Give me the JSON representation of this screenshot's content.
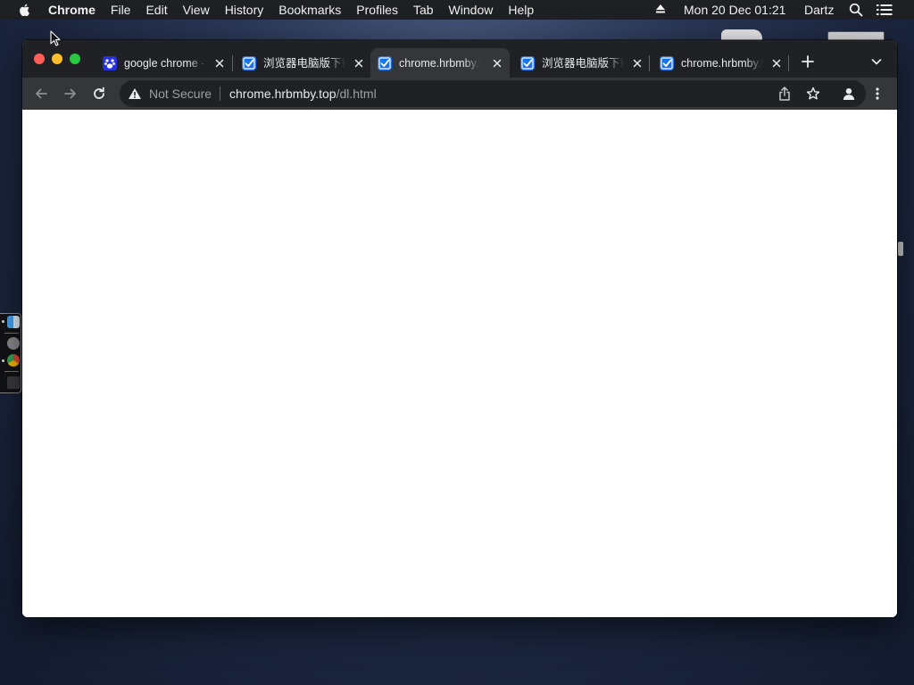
{
  "menubar": {
    "app_name": "Chrome",
    "menus": [
      "File",
      "Edit",
      "View",
      "History",
      "Bookmarks",
      "Profiles",
      "Tab",
      "Window",
      "Help"
    ],
    "clock": "Mon 20 Dec  01:21",
    "user": "Dartz"
  },
  "tabs": [
    {
      "title": "google chrome - 百度搜索",
      "favicon": "baidu-paw-icon",
      "active": false
    },
    {
      "title": "浏览器电脑版下载",
      "favicon": "checkbox-favicon-icon",
      "active": false
    },
    {
      "title": "chrome.hrbmby.top",
      "favicon": "checkbox-favicon-icon",
      "active": true
    },
    {
      "title": "浏览器电脑版下载",
      "favicon": "checkbox-favicon-icon",
      "active": false
    },
    {
      "title": "chrome.hrbmby.top",
      "favicon": "checkbox-favicon-icon",
      "active": false
    }
  ],
  "omnibox": {
    "security_label": "Not Secure",
    "url_host": "chrome.hrbmby.top",
    "url_path": "/dl.html"
  },
  "colors": {
    "titlebar": "#202124",
    "toolbar": "#35363a",
    "favicon_blue": "#1a73e8",
    "page_background": "#ffffff"
  }
}
